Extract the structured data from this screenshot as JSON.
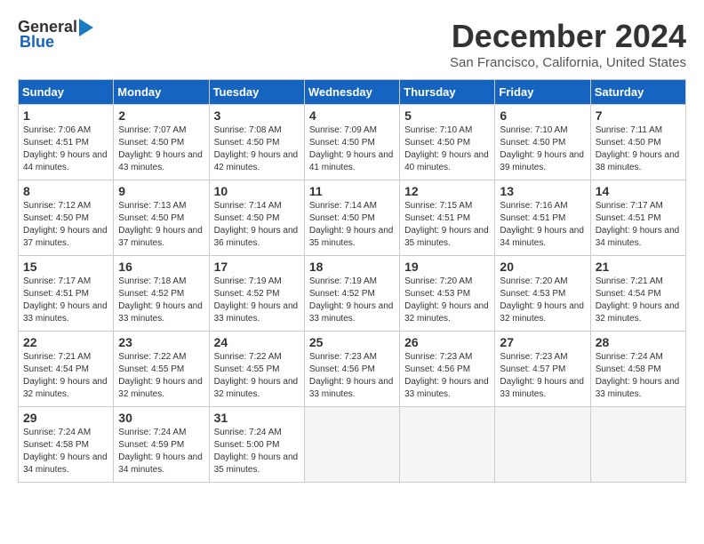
{
  "header": {
    "logo_general": "General",
    "logo_blue": "Blue",
    "title": "December 2024",
    "subtitle": "San Francisco, California, United States"
  },
  "days_of_week": [
    "Sunday",
    "Monday",
    "Tuesday",
    "Wednesday",
    "Thursday",
    "Friday",
    "Saturday"
  ],
  "weeks": [
    [
      {
        "day": 1,
        "sunrise": "7:06 AM",
        "sunset": "4:51 PM",
        "daylight": "9 hours and 44 minutes."
      },
      {
        "day": 2,
        "sunrise": "7:07 AM",
        "sunset": "4:50 PM",
        "daylight": "9 hours and 43 minutes."
      },
      {
        "day": 3,
        "sunrise": "7:08 AM",
        "sunset": "4:50 PM",
        "daylight": "9 hours and 42 minutes."
      },
      {
        "day": 4,
        "sunrise": "7:09 AM",
        "sunset": "4:50 PM",
        "daylight": "9 hours and 41 minutes."
      },
      {
        "day": 5,
        "sunrise": "7:10 AM",
        "sunset": "4:50 PM",
        "daylight": "9 hours and 40 minutes."
      },
      {
        "day": 6,
        "sunrise": "7:10 AM",
        "sunset": "4:50 PM",
        "daylight": "9 hours and 39 minutes."
      },
      {
        "day": 7,
        "sunrise": "7:11 AM",
        "sunset": "4:50 PM",
        "daylight": "9 hours and 38 minutes."
      }
    ],
    [
      {
        "day": 8,
        "sunrise": "7:12 AM",
        "sunset": "4:50 PM",
        "daylight": "9 hours and 37 minutes."
      },
      {
        "day": 9,
        "sunrise": "7:13 AM",
        "sunset": "4:50 PM",
        "daylight": "9 hours and 37 minutes."
      },
      {
        "day": 10,
        "sunrise": "7:14 AM",
        "sunset": "4:50 PM",
        "daylight": "9 hours and 36 minutes."
      },
      {
        "day": 11,
        "sunrise": "7:14 AM",
        "sunset": "4:50 PM",
        "daylight": "9 hours and 35 minutes."
      },
      {
        "day": 12,
        "sunrise": "7:15 AM",
        "sunset": "4:51 PM",
        "daylight": "9 hours and 35 minutes."
      },
      {
        "day": 13,
        "sunrise": "7:16 AM",
        "sunset": "4:51 PM",
        "daylight": "9 hours and 34 minutes."
      },
      {
        "day": 14,
        "sunrise": "7:17 AM",
        "sunset": "4:51 PM",
        "daylight": "9 hours and 34 minutes."
      }
    ],
    [
      {
        "day": 15,
        "sunrise": "7:17 AM",
        "sunset": "4:51 PM",
        "daylight": "9 hours and 33 minutes."
      },
      {
        "day": 16,
        "sunrise": "7:18 AM",
        "sunset": "4:52 PM",
        "daylight": "9 hours and 33 minutes."
      },
      {
        "day": 17,
        "sunrise": "7:19 AM",
        "sunset": "4:52 PM",
        "daylight": "9 hours and 33 minutes."
      },
      {
        "day": 18,
        "sunrise": "7:19 AM",
        "sunset": "4:52 PM",
        "daylight": "9 hours and 33 minutes."
      },
      {
        "day": 19,
        "sunrise": "7:20 AM",
        "sunset": "4:53 PM",
        "daylight": "9 hours and 32 minutes."
      },
      {
        "day": 20,
        "sunrise": "7:20 AM",
        "sunset": "4:53 PM",
        "daylight": "9 hours and 32 minutes."
      },
      {
        "day": 21,
        "sunrise": "7:21 AM",
        "sunset": "4:54 PM",
        "daylight": "9 hours and 32 minutes."
      }
    ],
    [
      {
        "day": 22,
        "sunrise": "7:21 AM",
        "sunset": "4:54 PM",
        "daylight": "9 hours and 32 minutes."
      },
      {
        "day": 23,
        "sunrise": "7:22 AM",
        "sunset": "4:55 PM",
        "daylight": "9 hours and 32 minutes."
      },
      {
        "day": 24,
        "sunrise": "7:22 AM",
        "sunset": "4:55 PM",
        "daylight": "9 hours and 32 minutes."
      },
      {
        "day": 25,
        "sunrise": "7:23 AM",
        "sunset": "4:56 PM",
        "daylight": "9 hours and 33 minutes."
      },
      {
        "day": 26,
        "sunrise": "7:23 AM",
        "sunset": "4:56 PM",
        "daylight": "9 hours and 33 minutes."
      },
      {
        "day": 27,
        "sunrise": "7:23 AM",
        "sunset": "4:57 PM",
        "daylight": "9 hours and 33 minutes."
      },
      {
        "day": 28,
        "sunrise": "7:24 AM",
        "sunset": "4:58 PM",
        "daylight": "9 hours and 33 minutes."
      }
    ],
    [
      {
        "day": 29,
        "sunrise": "7:24 AM",
        "sunset": "4:58 PM",
        "daylight": "9 hours and 34 minutes."
      },
      {
        "day": 30,
        "sunrise": "7:24 AM",
        "sunset": "4:59 PM",
        "daylight": "9 hours and 34 minutes."
      },
      {
        "day": 31,
        "sunrise": "7:24 AM",
        "sunset": "5:00 PM",
        "daylight": "9 hours and 35 minutes."
      },
      null,
      null,
      null,
      null
    ]
  ]
}
